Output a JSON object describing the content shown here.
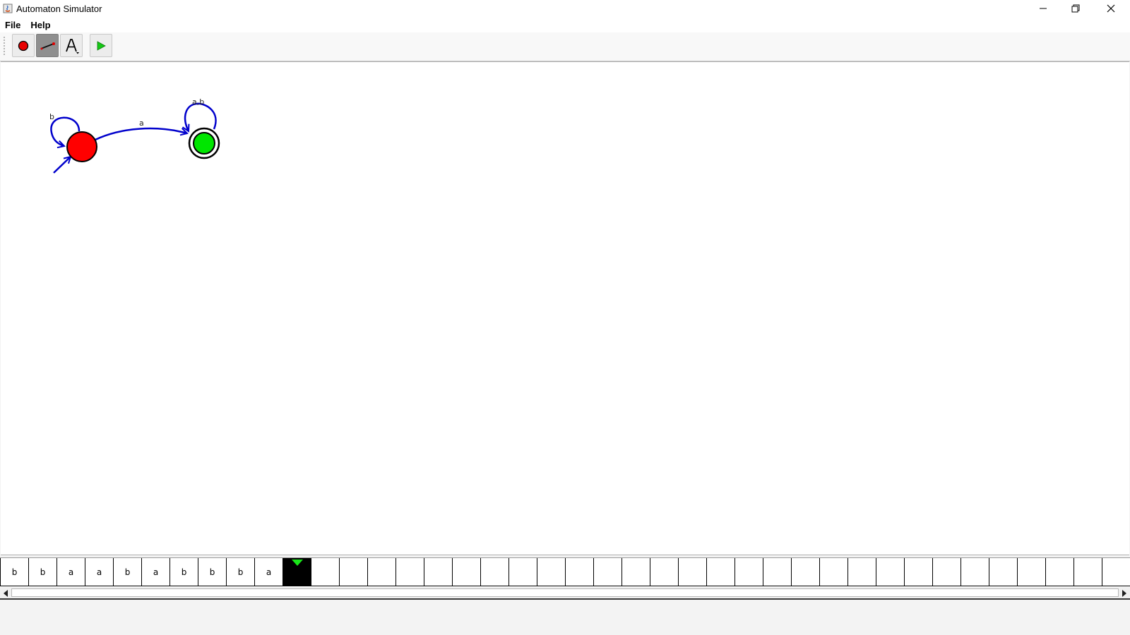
{
  "window": {
    "title": "Automaton Simulator",
    "icons": {
      "app": "java-icon",
      "minimize": "minimize-icon",
      "maximize": "restore-icon",
      "close": "close-icon"
    }
  },
  "menu": {
    "items": [
      "File",
      "Help"
    ]
  },
  "toolbar": {
    "buttons": [
      {
        "name": "add-state",
        "icon": "red-circle-icon",
        "selected": false
      },
      {
        "name": "add-transition",
        "icon": "arrow-line-icon",
        "selected": true
      },
      {
        "name": "edit-label",
        "icon": "text-a-icon",
        "selected": false
      },
      {
        "name": "run",
        "icon": "play-icon",
        "selected": false
      }
    ]
  },
  "automaton": {
    "states": [
      {
        "id": "q0",
        "initial": true,
        "accepting": false,
        "color": "#ff0000"
      },
      {
        "id": "q1",
        "initial": false,
        "accepting": true,
        "color": "#00e600"
      }
    ],
    "transitions": [
      {
        "from": "q0",
        "to": "q0",
        "label": "b"
      },
      {
        "from": "q0",
        "to": "q1",
        "label": "a"
      },
      {
        "from": "q1",
        "to": "q1",
        "label": "a,b"
      }
    ],
    "edge_color": "#0000cc"
  },
  "tape": {
    "symbols": [
      "b",
      "b",
      "a",
      "a",
      "b",
      "a",
      "b",
      "b",
      "b",
      "a"
    ],
    "head_index": 10,
    "head_color": "#19e619"
  }
}
